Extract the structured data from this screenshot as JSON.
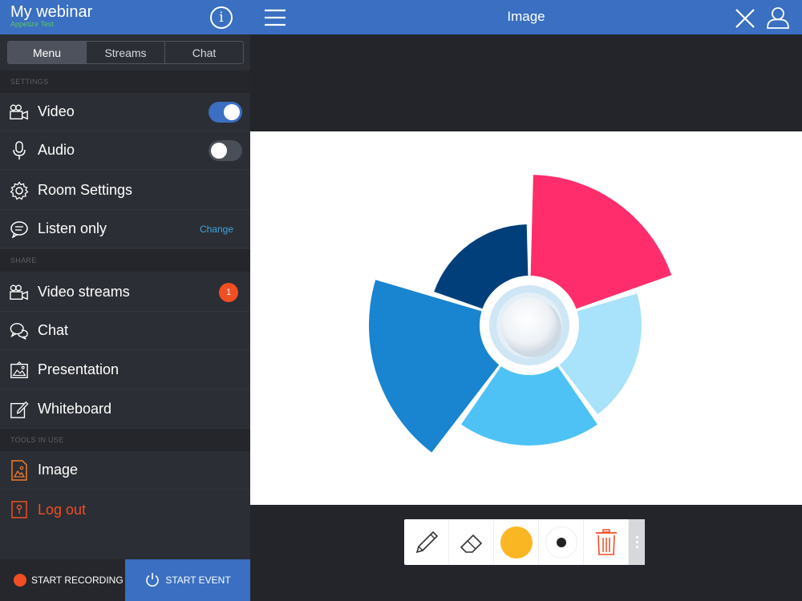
{
  "sidebar": {
    "title": "My webinar",
    "subtitle": "Appetize Test",
    "tabs": [
      {
        "label": "Menu",
        "active": true
      },
      {
        "label": "Streams",
        "active": false
      },
      {
        "label": "Chat",
        "active": false
      }
    ],
    "sections": {
      "settings": "SETTINGS",
      "share": "SHARE",
      "tools_in_use": "TOOLS IN USE"
    },
    "settings_items": {
      "video": {
        "label": "Video",
        "icon": "video-camera-icon",
        "toggle": true
      },
      "audio": {
        "label": "Audio",
        "icon": "microphone-icon",
        "toggle": false
      },
      "room_settings": {
        "label": "Room Settings",
        "icon": "gear-icon"
      },
      "listen_only": {
        "label": "Listen only",
        "icon": "speech-bubble-icon",
        "action": "Change"
      }
    },
    "share_items": {
      "video_streams": {
        "label": "Video streams",
        "icon": "video-camera-icon",
        "badge": "1"
      },
      "chat": {
        "label": "Chat",
        "icon": "chat-bubbles-icon"
      },
      "presentation": {
        "label": "Presentation",
        "icon": "presentation-icon"
      },
      "whiteboard": {
        "label": "Whiteboard",
        "icon": "whiteboard-icon"
      }
    },
    "tools_items": {
      "image": {
        "label": "Image",
        "icon": "image-file-icon"
      },
      "logout": {
        "label": "Log out",
        "icon": "logout-icon"
      }
    },
    "footer": {
      "record_label": "START RECORDING",
      "start_label": "START EVENT"
    }
  },
  "main": {
    "title": "Image",
    "toolbar": {
      "tools": [
        "pencil-icon",
        "eraser-icon",
        "color-swatch",
        "stroke-size",
        "trash-icon",
        "more-icon"
      ],
      "selected_color": "#fbb624"
    }
  },
  "colors": {
    "accent": "#3a6fc1",
    "sidebar_bg": "#2b2e34",
    "alert": "#f04e23",
    "link": "#3fa3e0",
    "segments": [
      "#ff2d6b",
      "#a8e2fb",
      "#4fc2f5",
      "#1984d0",
      "#003f7a"
    ]
  }
}
